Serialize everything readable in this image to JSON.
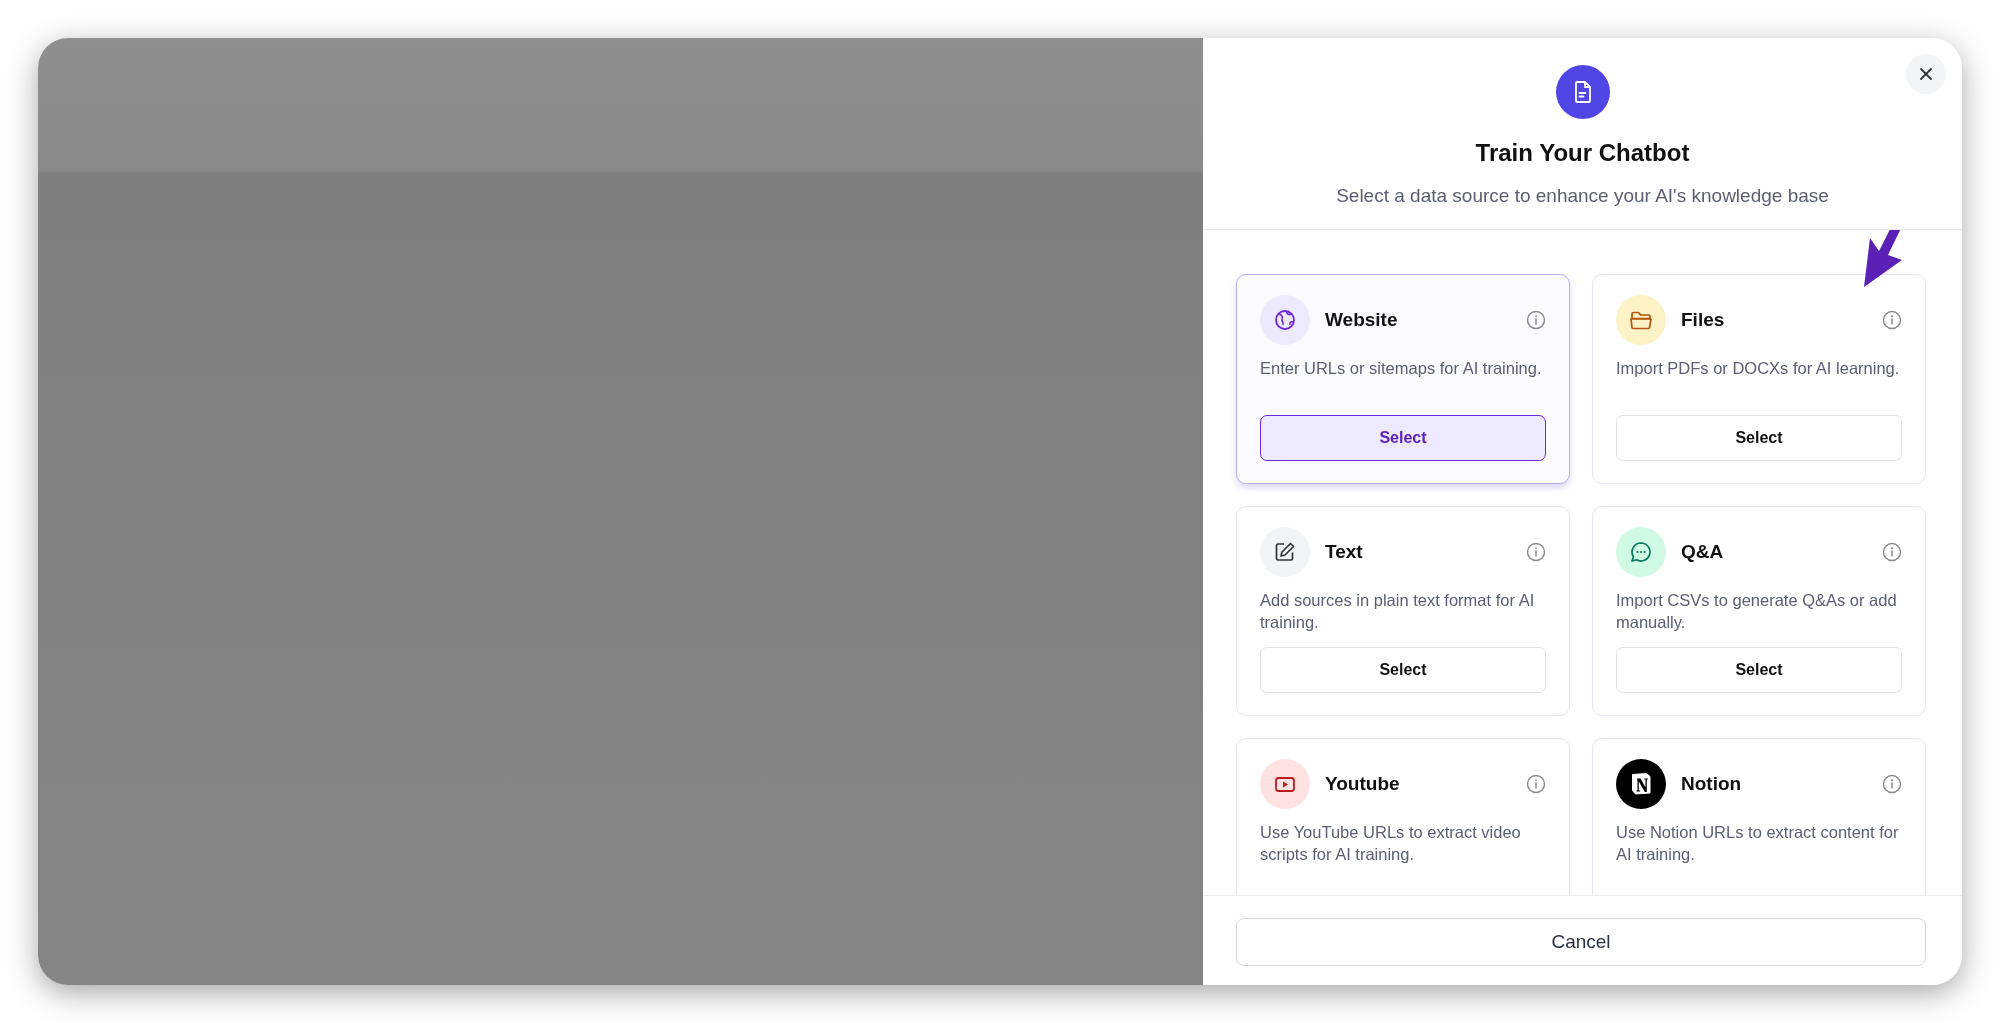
{
  "dialog": {
    "title": "Train Your Chatbot",
    "subtitle": "Select a data source to enhance your AI's knowledge base",
    "sources": [
      {
        "kind": "website",
        "name": "Website",
        "description": "Enter URLs or sitemaps for AI training.",
        "button": "Select",
        "selected": true
      },
      {
        "kind": "files",
        "name": "Files",
        "description": "Import PDFs or DOCXs for AI learning.",
        "button": "Select",
        "selected": false
      },
      {
        "kind": "text",
        "name": "Text",
        "description": "Add sources in plain text format for AI training.",
        "button": "Select",
        "selected": false
      },
      {
        "kind": "qa",
        "name": "Q&A",
        "description": "Import CSVs to generate Q&As or add manually.",
        "button": "Select",
        "selected": false
      },
      {
        "kind": "youtube",
        "name": "Youtube",
        "description": "Use YouTube URLs to extract video scripts for AI training.",
        "selected": false
      },
      {
        "kind": "notion",
        "name": "Notion",
        "description": "Use Notion URLs to extract content for AI training.",
        "selected": false
      }
    ],
    "cancel_button": "Cancel"
  }
}
